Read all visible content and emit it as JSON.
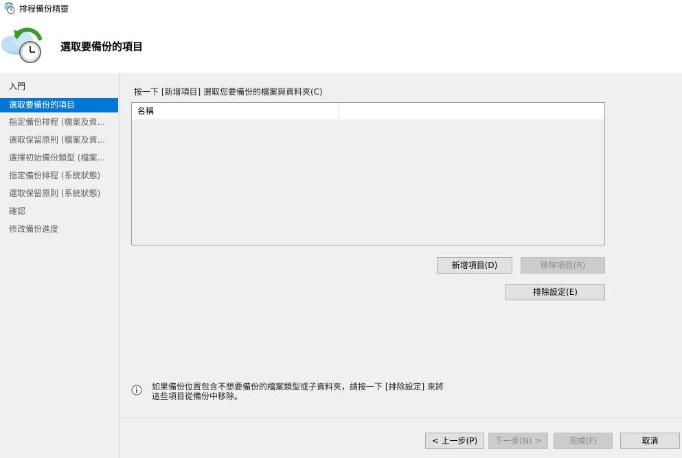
{
  "window": {
    "title": "排程備份精靈"
  },
  "header": {
    "page_title": "選取要備份的項目"
  },
  "sidebar": {
    "items": [
      {
        "label": "入門"
      },
      {
        "label": "選取要備份的項目"
      },
      {
        "label": "指定備份排程 (檔案及資..."
      },
      {
        "label": "選取保留原則 (檔案及資..."
      },
      {
        "label": "選擇初始備份類型 (檔案..."
      },
      {
        "label": "指定備份排程 (系統狀態)"
      },
      {
        "label": "選取保留原則 (系統狀態)"
      },
      {
        "label": "確認"
      },
      {
        "label": "修改備份進度"
      }
    ],
    "selected_index": 1
  },
  "main": {
    "instruction": "按一下 [新增項目] 選取您要備份的檔案與資料夾(C)",
    "list": {
      "columns": [
        "名稱",
        ""
      ],
      "rows": []
    },
    "buttons": {
      "add": "新增項目(D)",
      "remove": "移除項目(R)",
      "exclude": "排除設定(E)"
    },
    "info_text": "如果備份位置包含不想要備份的檔案類型或子資料夾，請按一下 [排除設定] 來將\n這些項目從備份中移除。"
  },
  "footer": {
    "prev": "< 上一步(P)",
    "next": "下一步(N) >",
    "finish": "完成(F)",
    "cancel": "取消"
  },
  "colors": {
    "accent": "#0078d7",
    "window_bg": "#f0f0f0",
    "header_bg": "#ffffff"
  }
}
